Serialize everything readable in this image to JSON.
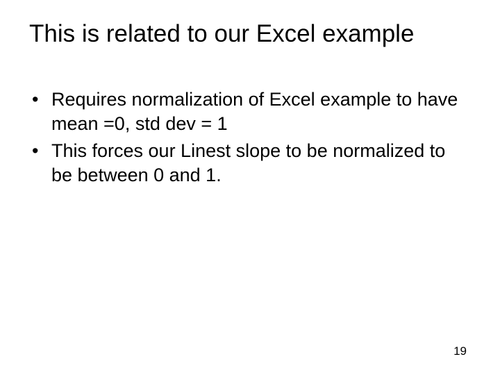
{
  "slide": {
    "title": "This is related to our Excel example",
    "bullets": [
      "Requires normalization of Excel example to have mean =0, std dev = 1",
      "This forces our Linest slope to be normalized to be between 0 and 1."
    ],
    "page_number": "19"
  }
}
